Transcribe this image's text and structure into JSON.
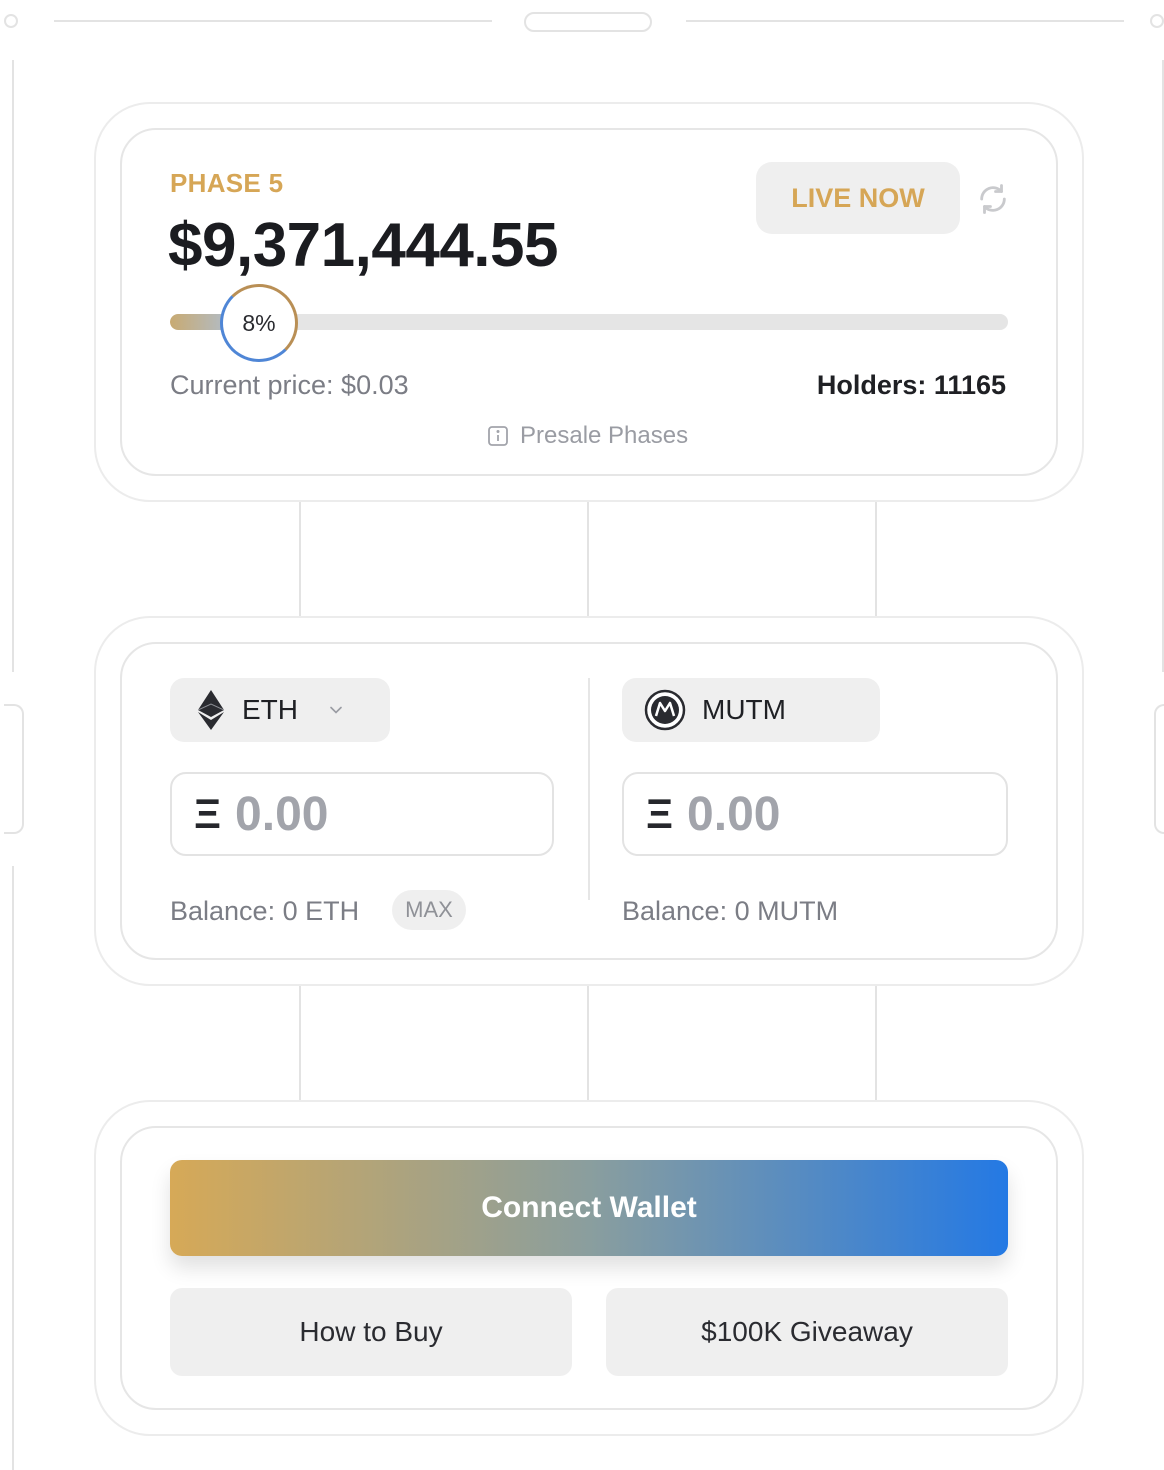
{
  "presale": {
    "phase": "PHASE 5",
    "raised": "$9,371,444.55",
    "status_badge": "LIVE NOW",
    "progress_label": "8%",
    "progress_fraction": 0.08,
    "current_price": "Current price: $0.03",
    "holders": "Holders: 11165",
    "phases_link": "Presale Phases"
  },
  "swap": {
    "from": {
      "token": "ETH",
      "symbol": "Ξ",
      "value": "0.00",
      "balance": "Balance: 0 ETH",
      "max_label": "MAX"
    },
    "to": {
      "token": "MUTM",
      "symbol": "Ξ",
      "value": "0.00",
      "balance": "Balance: 0 MUTM"
    }
  },
  "actions": {
    "connect": "Connect Wallet",
    "how_to_buy": "How to Buy",
    "giveaway": "$100K Giveaway"
  },
  "colors": {
    "gold": "#d6a656",
    "blue": "#2479e4",
    "muted": "#7b7d85"
  },
  "icons": [
    "refresh-icon",
    "info-icon",
    "ethereum-icon",
    "chevron-down-icon",
    "mutm-logo-icon"
  ]
}
